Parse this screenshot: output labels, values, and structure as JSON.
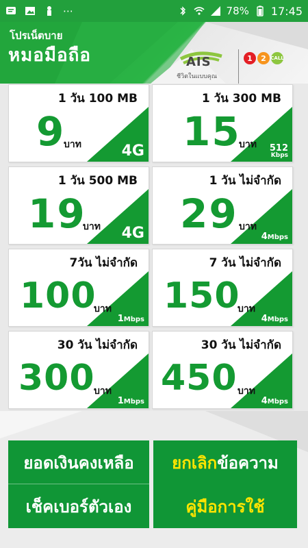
{
  "status": {
    "battery": "78%",
    "time": "17:45"
  },
  "header": {
    "promo_top": "โปรเน็ตบาย",
    "promo_main": "หมอมือถือ",
    "ais_text": "AIS",
    "ais_slogan": "ชีวิตในแบบคุณ",
    "call_text": "CALL"
  },
  "packages": [
    {
      "duration": "1 วัน 100 MB",
      "price": "9",
      "unit": "บาท",
      "speed": "4G"
    },
    {
      "duration": "1 วัน 300 MB",
      "price": "15",
      "unit": "บาท",
      "speed": "512",
      "speed_unit": "Kbps"
    },
    {
      "duration": "1 วัน 500 MB",
      "price": "19",
      "unit": "บาท",
      "speed": "4G"
    },
    {
      "duration": "1 วัน ไม่จำกัด",
      "price": "29",
      "unit": "บาท",
      "speed": "4",
      "speed_unit": "Mbps"
    },
    {
      "duration": "7วัน ไม่จำกัด",
      "price": "100",
      "unit": "บาท",
      "speed": "1",
      "speed_unit": "Mbps"
    },
    {
      "duration": "7 วัน ไม่จำกัด",
      "price": "150",
      "unit": "บาท",
      "speed": "4",
      "speed_unit": "Mbps"
    },
    {
      "duration": "30 วัน ไม่จำกัด",
      "price": "300",
      "unit": "บาท",
      "speed": "1",
      "speed_unit": "Mbps"
    },
    {
      "duration": "30 วัน ไม่จำกัด",
      "price": "450",
      "unit": "บาท",
      "speed": "4",
      "speed_unit": "Mbps"
    }
  ],
  "buttons": {
    "balance": "ยอดเงินคงเหลือ",
    "check_number": "เช็คเบอร์ตัวเอง",
    "cancel_a": "ยกเลิก",
    "cancel_b": "ข้อความ",
    "guide": "คู่มือการใช้"
  },
  "colors": {
    "green": "#149a32",
    "yellow": "#ffe400"
  }
}
